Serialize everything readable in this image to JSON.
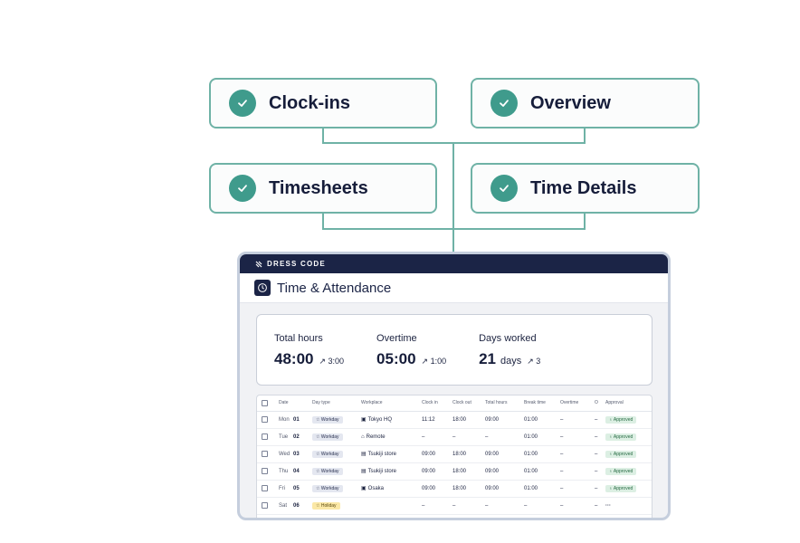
{
  "features": [
    {
      "label": "Clock-ins",
      "icon": "check-icon"
    },
    {
      "label": "Overview",
      "icon": "check-icon"
    },
    {
      "label": "Timesheets",
      "icon": "check-icon"
    },
    {
      "label": "Time Details",
      "icon": "check-icon"
    }
  ],
  "app": {
    "brand": "DRESS CODE",
    "title": "Time & Attendance"
  },
  "stats": [
    {
      "label": "Total hours",
      "value": "48:00",
      "unit": "",
      "delta": "↗ 3:00"
    },
    {
      "label": "Overtime",
      "value": "05:00",
      "unit": "",
      "delta": "↗ 1:00"
    },
    {
      "label": "Days worked",
      "value": "21",
      "unit": "days",
      "delta": "↗ 3"
    }
  ],
  "table": {
    "headers": [
      "Date",
      "Day type",
      "Workplace",
      "Clock in",
      "Clock out",
      "Total hours",
      "Break time",
      "Overtime",
      "O",
      "Approval"
    ],
    "rows": [
      {
        "day": "Mon",
        "num": "01",
        "type": "☆ Workday",
        "workplace": "Tokyo HQ",
        "wp_icon": "building-icon",
        "clock_in": "11:12",
        "clock_out": "18:00",
        "total": "09:00",
        "break": "01:00",
        "overtime": "–",
        "o": "–",
        "approval": "♁ Approved"
      },
      {
        "day": "Tue",
        "num": "02",
        "type": "☆ Workday",
        "workplace": "Remote",
        "wp_icon": "home-icon",
        "clock_in": "–",
        "clock_out": "–",
        "total": "–",
        "break": "01:00",
        "overtime": "–",
        "o": "–",
        "approval": "♁ Approved"
      },
      {
        "day": "Wed",
        "num": "03",
        "type": "☆ Workday",
        "workplace": "Tsukiji store",
        "wp_icon": "store-icon",
        "clock_in": "09:00",
        "clock_out": "18:00",
        "total": "09:00",
        "break": "01:00",
        "overtime": "–",
        "o": "–",
        "approval": "♁ Approved"
      },
      {
        "day": "Thu",
        "num": "04",
        "type": "☆ Workday",
        "workplace": "Tsukiji store",
        "wp_icon": "store-icon",
        "clock_in": "09:00",
        "clock_out": "18:00",
        "total": "09:00",
        "break": "01:00",
        "overtime": "–",
        "o": "–",
        "approval": "♁ Approved"
      },
      {
        "day": "Fri",
        "num": "05",
        "type": "☆ Workday",
        "workplace": "Osaka",
        "wp_icon": "building-icon",
        "clock_in": "09:00",
        "clock_out": "18:00",
        "total": "09:00",
        "break": "01:00",
        "overtime": "–",
        "o": "–",
        "approval": "♁ Approved"
      },
      {
        "day": "Sat",
        "num": "06",
        "type": "☆ Holiday",
        "workplace": "",
        "wp_icon": "",
        "clock_in": "–",
        "clock_out": "–",
        "total": "–",
        "break": "–",
        "overtime": "–",
        "o": "–",
        "approval": "···"
      }
    ]
  },
  "colors": {
    "accent": "#3f9b8c",
    "connector": "#6fb2a6",
    "brand_bar": "#1b2446"
  }
}
